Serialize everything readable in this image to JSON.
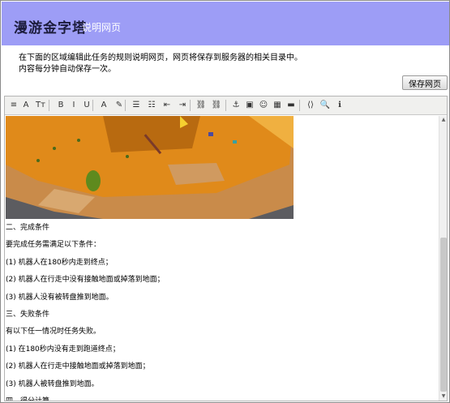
{
  "header": {
    "title": "漫游金字塔",
    "subtitle": "说明网页"
  },
  "description": {
    "line1": "在下面的区域编辑此任务的规则说明网页，网页将保存到服务器的相关目录中。",
    "line2": "内容每分钟自动保存一次。"
  },
  "save_button": "保存网页",
  "toolbar": {
    "icons": [
      "format-icon",
      "font-icon",
      "font-size-icon",
      "bold-icon",
      "italic-icon",
      "underline-icon",
      "text-color-icon",
      "highlight-icon",
      "ordered-list-icon",
      "unordered-list-icon",
      "outdent-icon",
      "indent-icon",
      "link-icon",
      "unlink-icon",
      "anchor-icon",
      "image-icon",
      "emoticon-icon",
      "table-icon",
      "horizontal-rule-icon",
      "source-icon",
      "preview-icon",
      "help-icon"
    ],
    "glyphs": [
      "≡",
      "A",
      "Tт",
      "B",
      "I",
      "U",
      "A",
      "✎",
      "☰",
      "☷",
      "⇤",
      "⇥",
      "⛓",
      "⛓",
      "⚓",
      "▣",
      "☺",
      "▦",
      "▬",
      "⟨⟩",
      "🔍",
      "ℹ"
    ]
  },
  "content": {
    "lines": [
      "二、完成条件",
      "要完成任务需满足以下条件：",
      "(1) 机器人在180秒内走到终点；",
      "(2) 机器人在行走中没有接触地面或掉落到地面；",
      "(3) 机器人没有被转盘推到地面。",
      "三、失败条件",
      "有以下任一情况时任务失败。",
      "(1) 在180秒内没有走到跑道终点；",
      "(2) 机器人在行走中接触地面或掉落到地面；",
      "(3) 机器人被转盘推到地面。",
      "四、得分计算"
    ]
  },
  "colors": {
    "header_bg": "#9d9df6",
    "toolbar_bg": "#f0f0ee"
  }
}
